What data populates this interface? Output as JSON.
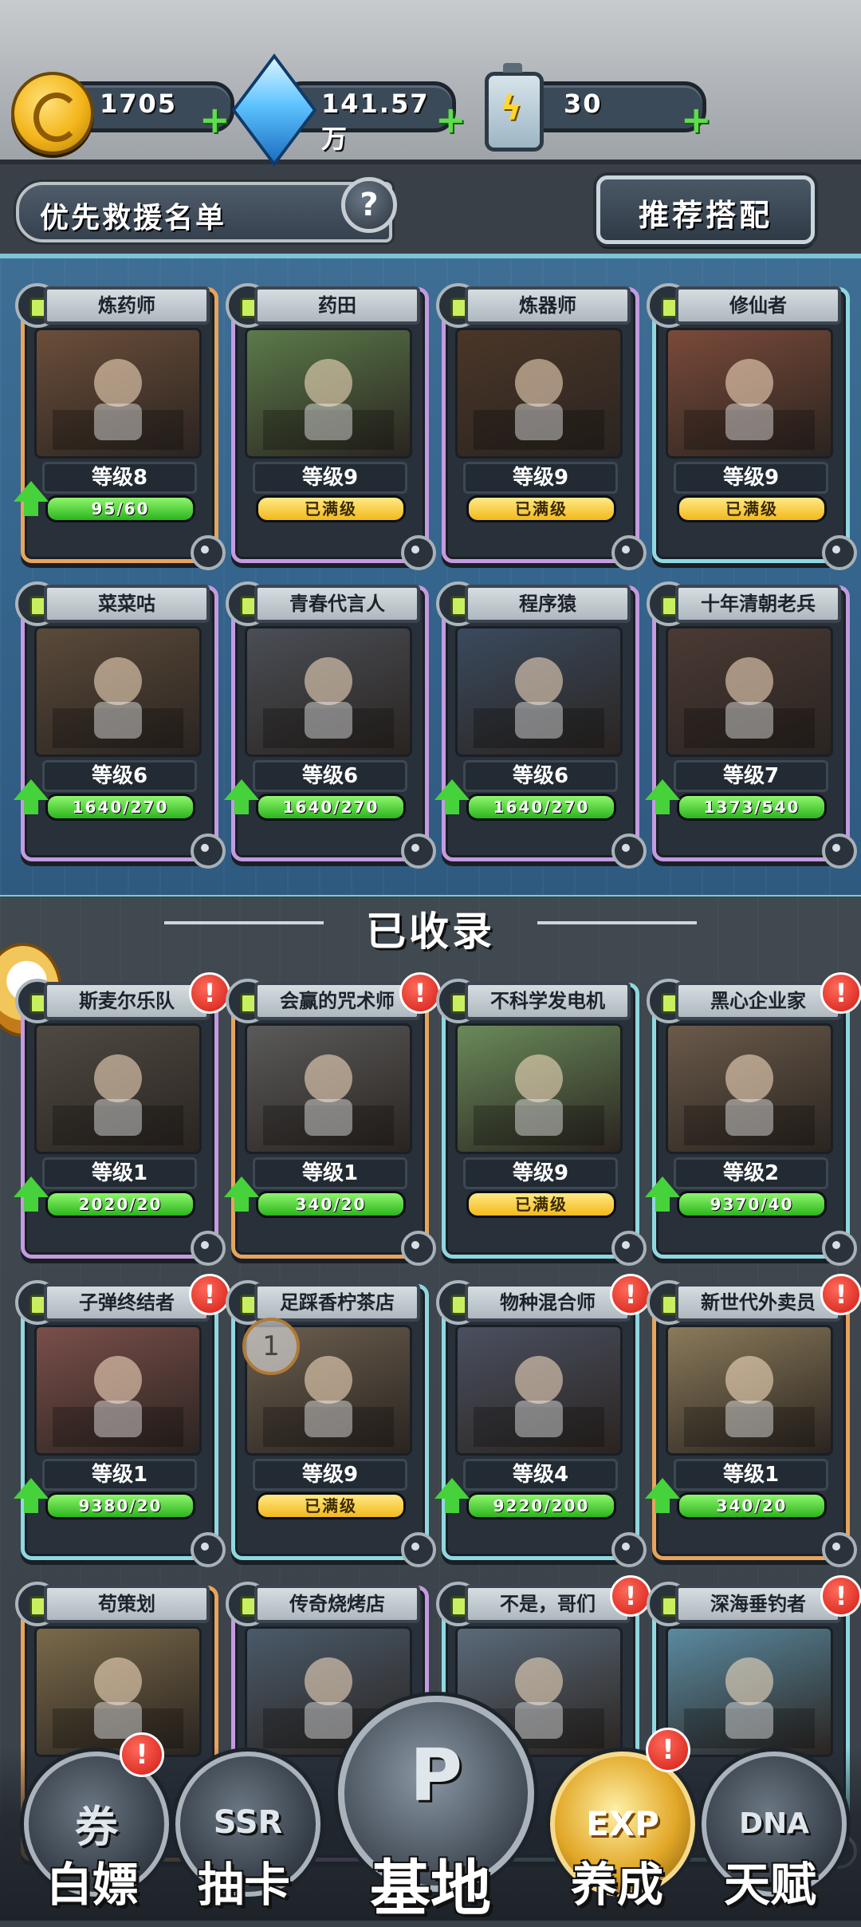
{
  "resources": {
    "gold": "1705",
    "gems": "141.57万",
    "energy": "30",
    "plus": "+"
  },
  "header": {
    "rescue_list": "优先救援名单",
    "help": "?",
    "recommend": "推荐搭配"
  },
  "collected_title": "已收录",
  "pin_number": "1",
  "alert_mark": "!",
  "priority_cards": [
    {
      "name": "炼药师",
      "level": "等级8",
      "progress": "95/60",
      "max": false,
      "upgradable": true,
      "frame": "orange",
      "fill": 1.0
    },
    {
      "name": "药田",
      "level": "等级9",
      "progress": "已满级",
      "max": true,
      "upgradable": false,
      "frame": "purple",
      "fill": 1.0
    },
    {
      "name": "炼器师",
      "level": "等级9",
      "progress": "已满级",
      "max": true,
      "upgradable": false,
      "frame": "purple",
      "fill": 1.0
    },
    {
      "name": "修仙者",
      "level": "等级9",
      "progress": "已满级",
      "max": true,
      "upgradable": false,
      "frame": "cyan",
      "fill": 1.0
    },
    {
      "name": "菜菜咕",
      "level": "等级6",
      "progress": "1640/270",
      "max": false,
      "upgradable": true,
      "frame": "purple",
      "fill": 1.0
    },
    {
      "name": "青春代言人",
      "level": "等级6",
      "progress": "1640/270",
      "max": false,
      "upgradable": true,
      "frame": "purple",
      "fill": 1.0
    },
    {
      "name": "程序猿",
      "level": "等级6",
      "progress": "1640/270",
      "max": false,
      "upgradable": true,
      "frame": "purple",
      "fill": 1.0
    },
    {
      "name": "十年清朝老兵",
      "level": "等级7",
      "progress": "1373/540",
      "max": false,
      "upgradable": true,
      "frame": "purple",
      "fill": 1.0
    }
  ],
  "collected_cards": [
    {
      "name": "斯麦尔乐队",
      "level": "等级1",
      "progress": "2020/20",
      "max": false,
      "upgradable": true,
      "frame": "purple",
      "alert": true,
      "fill": 1.0
    },
    {
      "name": "会赢的咒术师",
      "level": "等级1",
      "progress": "340/20",
      "max": false,
      "upgradable": true,
      "frame": "orange",
      "alert": true,
      "fill": 1.0
    },
    {
      "name": "不科学发电机",
      "level": "等级9",
      "progress": "已满级",
      "max": true,
      "upgradable": false,
      "frame": "cyan",
      "alert": false,
      "fill": 1.0
    },
    {
      "name": "黑心企业家",
      "level": "等级2",
      "progress": "9370/40",
      "max": false,
      "upgradable": true,
      "frame": "cyan",
      "alert": true,
      "fill": 1.0
    },
    {
      "name": "子弹终结者",
      "level": "等级1",
      "progress": "9380/20",
      "max": false,
      "upgradable": true,
      "frame": "cyan",
      "alert": true,
      "fill": 1.0
    },
    {
      "name": "足踩香柠茶店",
      "level": "等级9",
      "progress": "已满级",
      "max": true,
      "upgradable": false,
      "frame": "cyan",
      "alert": false,
      "fill": 1.0
    },
    {
      "name": "物种混合师",
      "level": "等级4",
      "progress": "9220/200",
      "max": false,
      "upgradable": true,
      "frame": "cyan",
      "alert": true,
      "fill": 1.0
    },
    {
      "name": "新世代外卖员",
      "level": "等级1",
      "progress": "340/20",
      "max": false,
      "upgradable": true,
      "frame": "orange",
      "alert": true,
      "fill": 1.0
    },
    {
      "name": "苟策划",
      "level": "",
      "progress": "",
      "max": false,
      "upgradable": false,
      "frame": "orange",
      "alert": false,
      "fill": 0
    },
    {
      "name": "传奇烧烤店",
      "level": "",
      "progress": "",
      "max": false,
      "upgradable": false,
      "frame": "purple",
      "alert": false,
      "fill": 0
    },
    {
      "name": "不是，哥们",
      "level": "",
      "progress": "",
      "max": false,
      "upgradable": false,
      "frame": "cyan",
      "alert": true,
      "fill": 0
    },
    {
      "name": "深海垂钓者",
      "level": "",
      "progress": "",
      "max": false,
      "upgradable": false,
      "frame": "cyan",
      "alert": true,
      "fill": 0
    }
  ],
  "card_art_colors": [
    "#6b4e3a",
    "#5b7a4a",
    "#4a3628",
    "#7a4a3a",
    "#5a4a3a",
    "#4a4e56",
    "#3a4a5e",
    "#4a3a34",
    "#4e4a42",
    "#5a5a5a",
    "#6a8a5a",
    "#6a5a4a",
    "#7a4e4a",
    "#6a5e4e",
    "#4a5060",
    "#8a7a5a",
    "#7a6a4a",
    "#4a5a6a",
    "#5a6a7a",
    "#5a8aa0"
  ],
  "nav": {
    "items": [
      {
        "label": "白嫖",
        "glyph": "券",
        "alert": true
      },
      {
        "label": "抽卡",
        "glyph": "SSR",
        "alert": false
      },
      {
        "label": "基地",
        "glyph": "P",
        "alert": false
      },
      {
        "label": "养成",
        "glyph": "EXP",
        "alert": true
      },
      {
        "label": "天赋",
        "glyph": "DNA",
        "alert": false
      }
    ]
  },
  "colors": {
    "accent_green": "#46d23a",
    "max_gold": "#f2b91c",
    "alert_red": "#d21b14",
    "panel_blue": "#35648c"
  }
}
